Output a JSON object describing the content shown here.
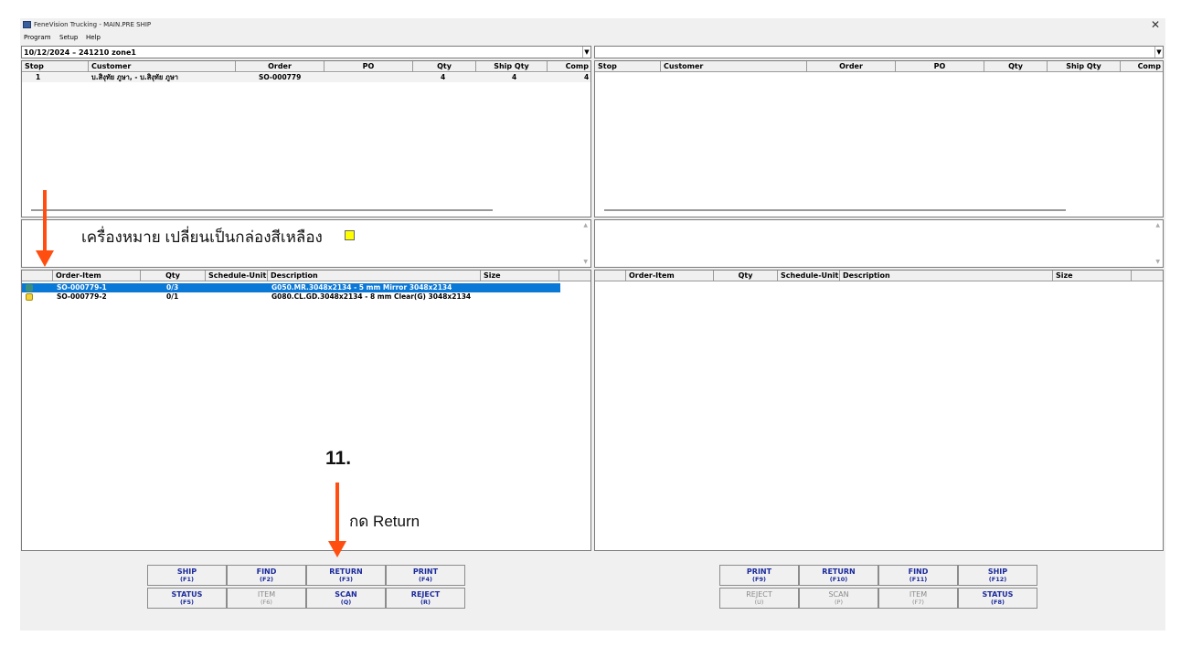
{
  "window": {
    "title": "FeneVision Trucking - MAIN.PRE SHIP",
    "close_glyph": "✕",
    "menu": [
      "Program",
      "Setup",
      "Help"
    ]
  },
  "left": {
    "combo_value": "10/12/2024 – 241210 zone1",
    "stops_headers": [
      "Stop",
      "Customer",
      "Order",
      "PO",
      "Qty",
      "Ship Qty",
      "Comp"
    ],
    "stops_rows": [
      {
        "stop": "1",
        "customer": "บ.สิงุทัย ภูษา, - บ.สิงุทัย ภูษา",
        "order": "SO-000779",
        "po": "",
        "qty": "4",
        "ship_qty": "4",
        "comp": "4"
      }
    ],
    "items_headers": [
      "Order-Item",
      "Qty",
      "Schedule-Unit",
      "Description",
      "Size"
    ],
    "items_rows": [
      {
        "icon": "pallet-icon",
        "order_item": "SO-000779-1",
        "qty": "0/3",
        "schedule_unit": "",
        "description": "G050.MR.3048x2134 - 5 mm Mirror 3048x2134",
        "size": "",
        "selected": true
      },
      {
        "icon": "box-icon",
        "order_item": "SO-000779-2",
        "qty": "0/1",
        "schedule_unit": "",
        "description": "G080.CL.GD.3048x2134 - 8 mm Clear(G) 3048x2134",
        "size": "",
        "selected": false
      }
    ],
    "buttons": [
      {
        "label": "SHIP",
        "key": "(F1)",
        "enabled": true
      },
      {
        "label": "FIND",
        "key": "(F2)",
        "enabled": true
      },
      {
        "label": "RETURN",
        "key": "(F3)",
        "enabled": true
      },
      {
        "label": "PRINT",
        "key": "(F4)",
        "enabled": true
      },
      {
        "label": "STATUS",
        "key": "(F5)",
        "enabled": true
      },
      {
        "label": "ITEM",
        "key": "(F6)",
        "enabled": false
      },
      {
        "label": "SCAN",
        "key": "(Q)",
        "enabled": true
      },
      {
        "label": "REJECT",
        "key": "(R)",
        "enabled": true
      }
    ]
  },
  "right": {
    "combo_value": "",
    "stops_headers": [
      "Stop",
      "Customer",
      "Order",
      "PO",
      "Qty",
      "Ship Qty",
      "Comp"
    ],
    "items_headers": [
      "Order-Item",
      "Qty",
      "Schedule-Unit",
      "Description",
      "Size"
    ],
    "buttons": [
      {
        "label": "PRINT",
        "key": "(F9)",
        "enabled": true
      },
      {
        "label": "RETURN",
        "key": "(F10)",
        "enabled": true
      },
      {
        "label": "FIND",
        "key": "(F11)",
        "enabled": true
      },
      {
        "label": "SHIP",
        "key": "(F12)",
        "enabled": true
      },
      {
        "label": "REJECT",
        "key": "(U)",
        "enabled": false
      },
      {
        "label": "SCAN",
        "key": "(P)",
        "enabled": false
      },
      {
        "label": "ITEM",
        "key": "(F7)",
        "enabled": false
      },
      {
        "label": "STATUS",
        "key": "(F8)",
        "enabled": true
      }
    ]
  },
  "annotations": {
    "marker_note": "เครื่องหมาย เปลี่ยนเป็นกล่องสีเหลือง",
    "step_number": "11.",
    "step_note": "กด Return",
    "arrow_color": "#ff4e0f"
  },
  "colors": {
    "selection": "#0a78d7",
    "button_text": "#1a2a9c"
  }
}
